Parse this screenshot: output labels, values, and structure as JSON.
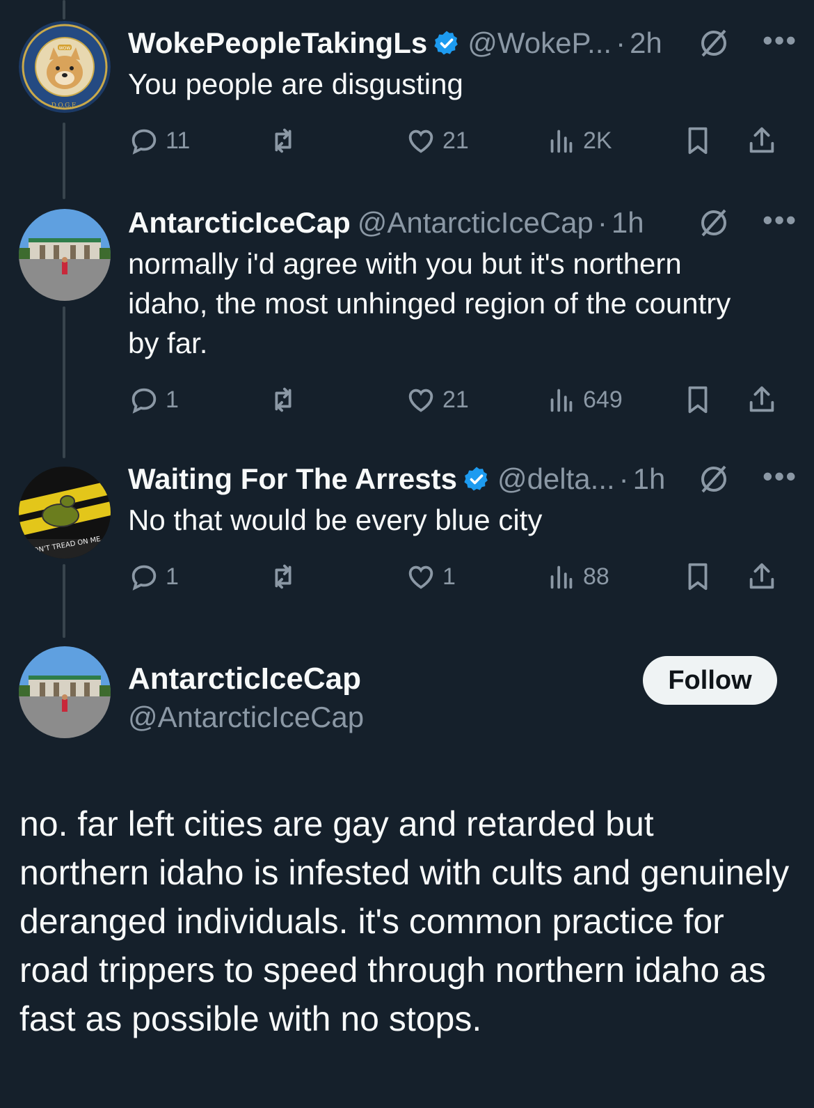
{
  "tweets": [
    {
      "name": "WokePeopleTakingLs",
      "verified": true,
      "handle": "@WokeP...",
      "dot": "·",
      "time": "2h",
      "more": "•••",
      "text": "You people are disgusting",
      "replies": "11",
      "reposts": "",
      "likes": "21",
      "views": "2K",
      "avatar_text": {
        "top": "DEPARTMENT OF GOVERNMENT EFFICIENCY",
        "bottom": "D.O.G.E.",
        "badge": "WOW"
      }
    },
    {
      "name": "AntarcticIceCap",
      "verified": false,
      "handle": "@AntarcticIceCap",
      "dot": "·",
      "time": "1h",
      "more": "•••",
      "text": "normally i'd agree with you but it's northern idaho, the most unhinged region of the country by far.",
      "replies": "1",
      "reposts": "",
      "likes": "21",
      "views": "649"
    },
    {
      "name": "Waiting For The Arrests",
      "verified": true,
      "handle": "@delta...",
      "dot": "·",
      "time": "1h",
      "more": "•••",
      "text": "No that would be every blue city",
      "replies": "1",
      "reposts": "",
      "likes": "1",
      "views": "88",
      "avatar_text": {
        "banner": "DON'T TREAD ON ME"
      }
    }
  ],
  "main": {
    "name": "AntarcticIceCap",
    "handle": "@AntarcticIceCap",
    "follow_label": "Follow",
    "text": "no. far left cities are gay and retarded but northern idaho is infested with cults and genuinely deranged individuals. it's common practice for road trippers to speed through northern idaho as fast as possible with no stops."
  },
  "colors": {
    "background": "#15202b",
    "text": "#f7f9f9",
    "muted": "#8b98a5",
    "verified": "#1d9bf0",
    "thread_line": "#38444d",
    "follow_bg": "#eff3f4"
  },
  "icons": [
    "reply-icon",
    "repost-icon",
    "like-icon",
    "views-icon",
    "bookmark-icon",
    "share-icon",
    "grok-icon",
    "verified-badge-icon"
  ]
}
